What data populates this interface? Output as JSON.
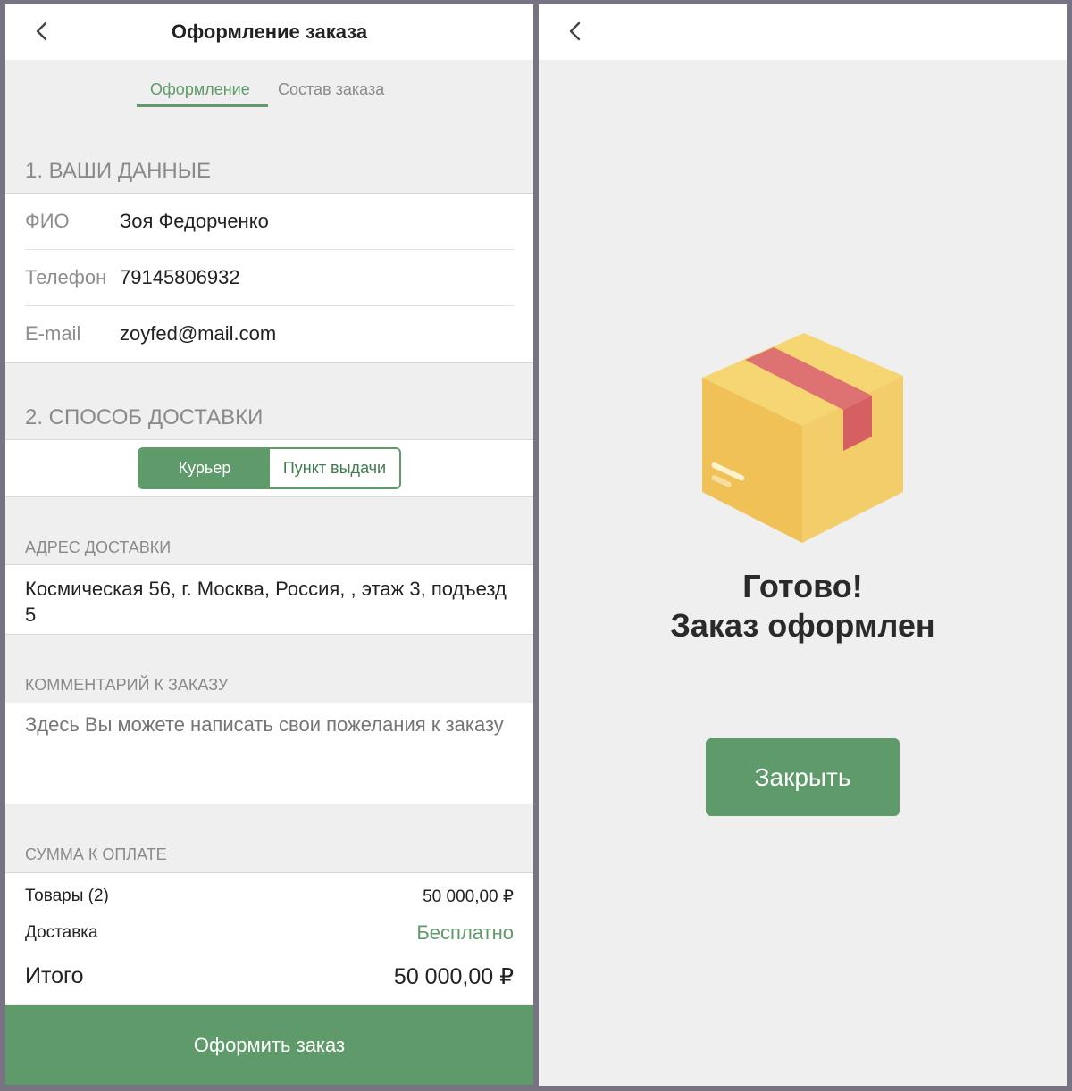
{
  "left": {
    "header": {
      "title": "Оформление заказа",
      "back_icon": "chevron-left-icon"
    },
    "tabs": [
      {
        "label": "Оформление",
        "active": true
      },
      {
        "label": "Состав заказа",
        "active": false
      }
    ],
    "section1": {
      "title": "1. ВАШИ ДАННЫЕ",
      "fields": [
        {
          "label": "ФИО",
          "value": "Зоя Федорченко"
        },
        {
          "label": "Телефон",
          "value": "79145806932"
        },
        {
          "label": "E-mail",
          "value": "zoyfed@mail.com"
        }
      ]
    },
    "section2": {
      "title": "2. СПОСОБ ДОСТАВКИ",
      "options": [
        {
          "label": "Курьер",
          "selected": true
        },
        {
          "label": "Пункт выдачи",
          "selected": false
        }
      ]
    },
    "address": {
      "caption": "АДРЕС ДОСТАВКИ",
      "value": "Космическая 56, г. Москва, Россия, , этаж 3, подъезд 5"
    },
    "comment": {
      "caption": "КОММЕНТАРИЙ К ЗАКАЗУ",
      "placeholder": "Здесь Вы можете написать свои пожелания к заказу"
    },
    "summary": {
      "caption": "СУММА К ОПЛАТЕ",
      "goods_label": "Товары (2)",
      "goods_value": "50 000,00 ₽",
      "delivery_label": "Доставка",
      "delivery_value": "Бесплатно",
      "total_label": "Итого",
      "total_value": "50 000,00 ₽"
    },
    "submit_label": "Оформить заказ"
  },
  "right": {
    "back_icon": "chevron-left-icon",
    "illustration": "cardboard-box-icon",
    "done_line1": "Готово!",
    "done_line2": "Заказ оформлен",
    "close_label": "Закрыть"
  },
  "colors": {
    "accent": "#5e9a6a",
    "background": "#efefef",
    "frame": "#777383"
  }
}
